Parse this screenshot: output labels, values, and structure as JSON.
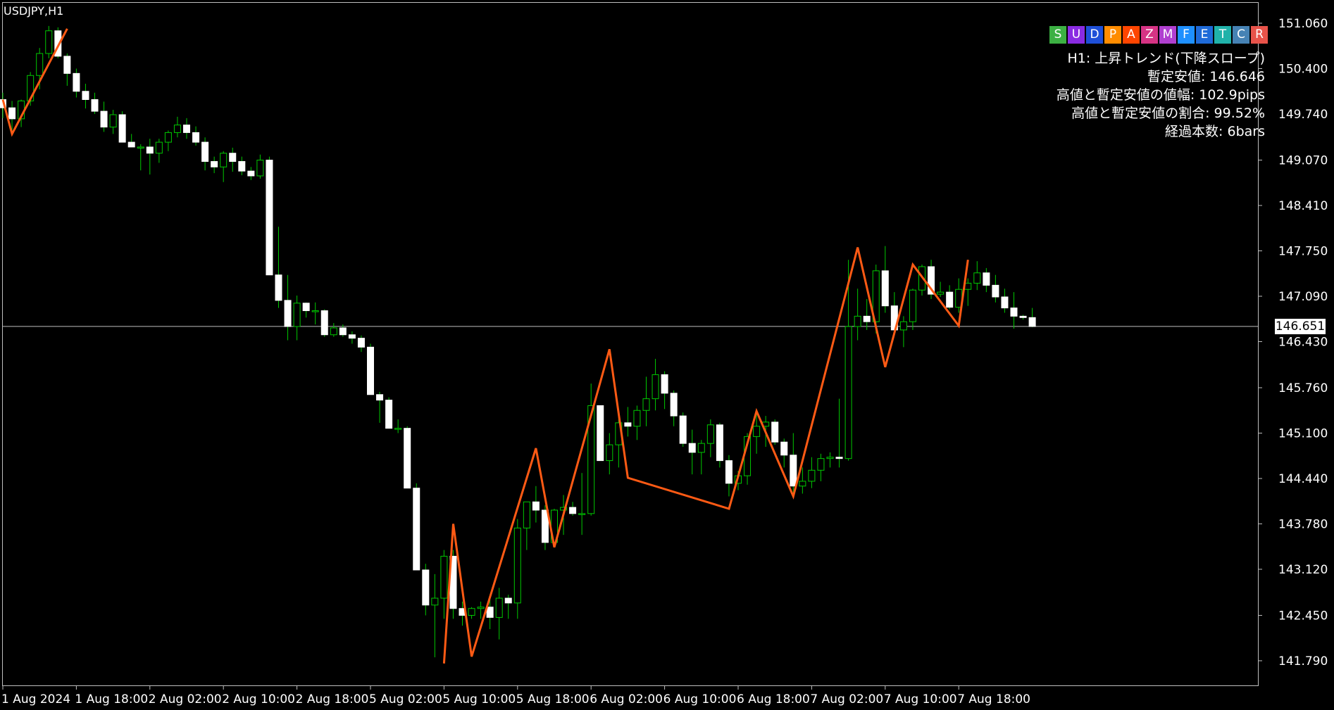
{
  "symbol_title": "USDJPY,H1",
  "toolbar": [
    {
      "label": "S",
      "color": "#3cb043"
    },
    {
      "label": "U",
      "color": "#8a2be2"
    },
    {
      "label": "D",
      "color": "#1e4fd8"
    },
    {
      "label": "P",
      "color": "#ff8c00"
    },
    {
      "label": "A",
      "color": "#ff4500"
    },
    {
      "label": "Z",
      "color": "#d63384"
    },
    {
      "label": "M",
      "color": "#b03fd0"
    },
    {
      "label": "F",
      "color": "#1e90ff"
    },
    {
      "label": "E",
      "color": "#1e6ad8"
    },
    {
      "label": "T",
      "color": "#20b2aa"
    },
    {
      "label": "C",
      "color": "#4682b4"
    },
    {
      "label": "R",
      "color": "#e8534a"
    }
  ],
  "info": {
    "line1": "H1: 上昇トレンド(下降スロープ)",
    "line2": "暫定安値: 146.646",
    "line3": "高値と暫定安値の値幅: 102.9pips",
    "line4": "高値と暫定安値の割合: 99.52%",
    "line5": "経過本数: 6bars"
  },
  "current_price": "146.651",
  "colors": {
    "bull": "#00c800",
    "bear_body": "#ffffff",
    "wick": "#00c800",
    "zigzag": "#ff5a14",
    "price_line": "#bfbfbf",
    "frame": "#bfbfbf"
  },
  "chart_data": {
    "type": "candlestick",
    "title": "USDJPY,H1",
    "ylim": [
      141.57,
      151.3
    ],
    "y_ticks": [
      "151.060",
      "150.400",
      "149.740",
      "149.070",
      "148.410",
      "147.750",
      "147.090",
      "146.430",
      "145.760",
      "145.100",
      "144.440",
      "143.780",
      "143.120",
      "142.450",
      "141.790"
    ],
    "y_tick_values": [
      151.06,
      150.4,
      149.74,
      149.07,
      148.41,
      147.75,
      147.09,
      146.43,
      145.76,
      145.1,
      144.44,
      143.78,
      143.12,
      142.45,
      141.79
    ],
    "x_labels": [
      "1 Aug 2024",
      "1 Aug 18:00",
      "2 Aug 02:00",
      "2 Aug 10:00",
      "2 Aug 18:00",
      "5 Aug 02:00",
      "5 Aug 10:00",
      "5 Aug 18:00",
      "6 Aug 02:00",
      "6 Aug 10:00",
      "6 Aug 18:00",
      "7 Aug 02:00",
      "7 Aug 10:00",
      "7 Aug 18:00"
    ],
    "x_label_bars": [
      0,
      8,
      16,
      24,
      32,
      40,
      48,
      56,
      64,
      72,
      80,
      88,
      96,
      104
    ],
    "candles": [
      [
        149.95,
        150.05,
        149.68,
        149.83
      ],
      [
        149.83,
        149.93,
        149.44,
        149.67
      ],
      [
        149.67,
        149.95,
        149.55,
        149.93
      ],
      [
        149.93,
        150.35,
        149.86,
        150.3
      ],
      [
        150.3,
        150.7,
        150.1,
        150.62
      ],
      [
        150.62,
        151.02,
        150.55,
        150.95
      ],
      [
        150.95,
        151.0,
        150.55,
        150.58
      ],
      [
        150.58,
        150.62,
        150.15,
        150.33
      ],
      [
        150.33,
        150.4,
        149.98,
        150.07
      ],
      [
        150.07,
        150.18,
        149.82,
        149.95
      ],
      [
        149.95,
        150.05,
        149.74,
        149.78
      ],
      [
        149.78,
        149.92,
        149.48,
        149.55
      ],
      [
        149.55,
        149.8,
        149.45,
        149.73
      ],
      [
        149.73,
        149.78,
        149.38,
        149.33
      ],
      [
        149.33,
        149.45,
        149.28,
        149.26
      ],
      [
        149.26,
        149.3,
        148.92,
        149.26
      ],
      [
        149.26,
        149.38,
        148.86,
        149.17
      ],
      [
        149.17,
        149.38,
        149.03,
        149.33
      ],
      [
        149.33,
        149.5,
        149.2,
        149.47
      ],
      [
        149.47,
        149.7,
        149.4,
        149.58
      ],
      [
        149.58,
        149.68,
        149.38,
        149.47
      ],
      [
        149.47,
        149.56,
        149.28,
        149.33
      ],
      [
        149.33,
        149.4,
        148.92,
        149.05
      ],
      [
        149.05,
        149.12,
        148.88,
        148.97
      ],
      [
        148.97,
        149.2,
        148.75,
        149.17
      ],
      [
        149.17,
        149.25,
        148.9,
        149.05
      ],
      [
        149.05,
        149.12,
        148.85,
        148.91
      ],
      [
        148.91,
        148.97,
        148.78,
        148.84
      ],
      [
        148.84,
        149.15,
        148.8,
        149.07
      ],
      [
        149.07,
        149.12,
        147.4,
        147.4
      ],
      [
        147.4,
        148.1,
        146.92,
        147.03
      ],
      [
        147.03,
        147.4,
        146.45,
        146.65
      ],
      [
        146.65,
        147.1,
        146.45,
        146.99
      ],
      [
        146.99,
        147.0,
        146.78,
        146.88
      ],
      [
        146.88,
        147.0,
        146.68,
        146.88
      ],
      [
        146.88,
        146.9,
        146.5,
        146.53
      ],
      [
        146.53,
        146.7,
        146.5,
        146.63
      ],
      [
        146.63,
        146.68,
        146.5,
        146.53
      ],
      [
        146.53,
        146.58,
        146.4,
        146.48
      ],
      [
        146.48,
        146.52,
        146.28,
        146.35
      ],
      [
        146.35,
        146.4,
        145.82,
        145.66
      ],
      [
        145.66,
        145.7,
        145.25,
        145.58
      ],
      [
        145.58,
        145.62,
        145.2,
        145.17
      ],
      [
        145.17,
        145.3,
        145.1,
        145.17
      ],
      [
        145.17,
        145.2,
        144.42,
        144.3
      ],
      [
        144.3,
        144.37,
        143.11,
        143.11
      ],
      [
        143.11,
        143.2,
        142.45,
        142.6
      ],
      [
        142.6,
        143.05,
        141.84,
        142.7
      ],
      [
        142.7,
        143.4,
        142.4,
        143.31
      ],
      [
        143.31,
        143.4,
        142.4,
        142.55
      ],
      [
        142.55,
        142.65,
        142.3,
        142.45
      ],
      [
        142.45,
        142.57,
        142.4,
        142.55
      ],
      [
        142.55,
        142.65,
        142.4,
        142.57
      ],
      [
        142.57,
        142.68,
        142.25,
        142.42
      ],
      [
        142.42,
        142.85,
        142.1,
        142.7
      ],
      [
        142.7,
        142.75,
        142.4,
        142.63
      ],
      [
        142.63,
        143.85,
        142.4,
        143.72
      ],
      [
        143.72,
        144.1,
        143.4,
        144.1
      ],
      [
        144.1,
        144.33,
        143.8,
        143.98
      ],
      [
        143.98,
        144.05,
        143.4,
        143.51
      ],
      [
        143.51,
        144.0,
        143.5,
        143.98
      ],
      [
        143.98,
        144.2,
        143.62,
        144.02
      ],
      [
        144.02,
        144.1,
        143.9,
        143.93
      ],
      [
        143.93,
        144.52,
        143.62,
        143.93
      ],
      [
        143.93,
        145.82,
        143.9,
        145.5
      ],
      [
        145.5,
        145.5,
        144.7,
        144.7
      ],
      [
        144.7,
        145.1,
        144.5,
        144.93
      ],
      [
        144.93,
        145.45,
        144.6,
        145.25
      ],
      [
        145.25,
        145.48,
        145.05,
        145.2
      ],
      [
        145.2,
        145.5,
        145.0,
        145.43
      ],
      [
        145.43,
        145.92,
        145.2,
        145.6
      ],
      [
        145.6,
        146.18,
        145.43,
        145.95
      ],
      [
        145.95,
        146.0,
        145.45,
        145.68
      ],
      [
        145.68,
        145.72,
        145.2,
        145.35
      ],
      [
        145.35,
        145.4,
        144.9,
        144.95
      ],
      [
        144.95,
        145.15,
        144.5,
        144.82
      ],
      [
        144.82,
        145.0,
        144.5,
        144.95
      ],
      [
        144.95,
        145.3,
        144.75,
        145.22
      ],
      [
        145.22,
        145.25,
        144.6,
        144.7
      ],
      [
        144.7,
        144.78,
        144.18,
        144.37
      ],
      [
        144.37,
        144.55,
        144.27,
        144.48
      ],
      [
        144.48,
        145.1,
        144.35,
        145.05
      ],
      [
        145.05,
        145.4,
        144.8,
        145.2
      ],
      [
        145.2,
        145.35,
        144.9,
        145.26
      ],
      [
        145.26,
        145.3,
        144.93,
        144.97
      ],
      [
        144.97,
        145.02,
        144.6,
        144.78
      ],
      [
        144.78,
        145.1,
        144.2,
        144.33
      ],
      [
        144.33,
        144.6,
        144.22,
        144.4
      ],
      [
        144.4,
        144.75,
        144.3,
        144.56
      ],
      [
        144.56,
        144.8,
        144.4,
        144.73
      ],
      [
        144.73,
        144.82,
        144.6,
        144.75
      ],
      [
        144.75,
        145.6,
        144.6,
        144.73
      ],
      [
        144.73,
        147.62,
        144.7,
        146.65
      ],
      [
        146.65,
        147.2,
        146.45,
        146.8
      ],
      [
        146.8,
        147.05,
        146.6,
        146.72
      ],
      [
        146.72,
        147.55,
        146.55,
        147.46
      ],
      [
        147.46,
        147.82,
        146.85,
        146.95
      ],
      [
        146.95,
        147.15,
        146.55,
        146.6
      ],
      [
        146.6,
        146.8,
        146.35,
        146.72
      ],
      [
        146.72,
        147.2,
        146.6,
        147.18
      ],
      [
        147.18,
        147.55,
        147.1,
        147.52
      ],
      [
        147.52,
        147.62,
        147.05,
        147.12
      ],
      [
        147.12,
        147.3,
        147.08,
        147.15
      ],
      [
        147.15,
        147.25,
        146.9,
        146.93
      ],
      [
        146.93,
        147.35,
        146.85,
        147.19
      ],
      [
        147.19,
        147.35,
        146.95,
        147.28
      ],
      [
        147.28,
        147.6,
        147.18,
        147.43
      ],
      [
        147.43,
        147.5,
        147.15,
        147.25
      ],
      [
        147.25,
        147.4,
        147.0,
        147.08
      ],
      [
        147.08,
        147.2,
        146.85,
        146.92
      ],
      [
        146.92,
        147.15,
        146.62,
        146.8
      ],
      [
        146.8,
        146.82,
        146.75,
        146.78
      ],
      [
        146.78,
        146.92,
        146.64,
        146.65
      ]
    ],
    "zigzag": [
      [
        0,
        149.95
      ],
      [
        1,
        149.45
      ],
      [
        7,
        150.98
      ],
      [],
      [
        48,
        141.75
      ],
      [
        49,
        143.78
      ],
      [
        51,
        141.85
      ],
      [
        58,
        144.88
      ],
      [
        60,
        143.44
      ],
      [
        66,
        146.32
      ],
      [
        68,
        144.45
      ],
      [
        79,
        144.0
      ],
      [
        82,
        145.42
      ],
      [
        86,
        144.18
      ],
      [
        93,
        147.8
      ],
      [
        96,
        146.06
      ],
      [
        99,
        147.55
      ],
      [
        104,
        146.66
      ],
      [
        105,
        147.62
      ]
    ]
  }
}
